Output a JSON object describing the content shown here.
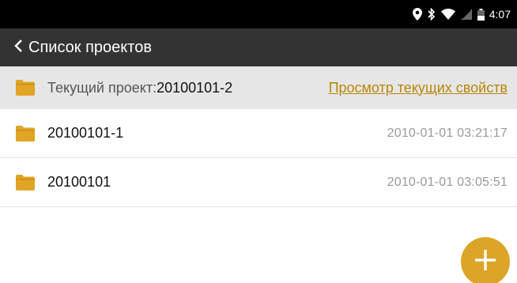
{
  "status_bar": {
    "time": "4:07",
    "icons": [
      "location-icon",
      "bluetooth-icon",
      "wifi-icon",
      "signal-icon",
      "battery-icon"
    ]
  },
  "app_bar": {
    "back_icon": "chevron-left-icon",
    "title": "Список проектов"
  },
  "current_project": {
    "label": "Текущий проект:",
    "value": "20100101-2",
    "link": "Просмотр текущих свойств"
  },
  "projects": [
    {
      "name": "20100101-1",
      "date": "2010-01-01 03:21:17"
    },
    {
      "name": "20100101",
      "date": "2010-01-01 03:05:51"
    }
  ],
  "fab": {
    "icon": "plus-icon"
  },
  "colors": {
    "status_bar": "#000000",
    "app_bar": "#333333",
    "current_row": "#e6e6e6",
    "folder": "#e0a526",
    "link": "#b8860b",
    "fab": "#dca528"
  }
}
